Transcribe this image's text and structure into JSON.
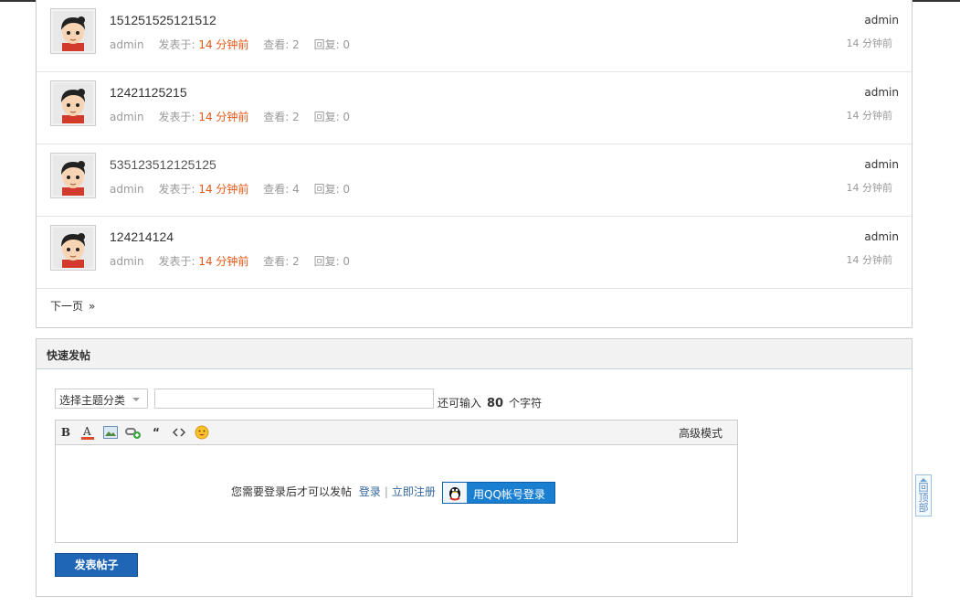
{
  "threads": [
    {
      "subject": "151251525121512",
      "author": "admin",
      "posted_label": "发表于:",
      "posted_time": "14 分钟前",
      "views": "查看: 2",
      "replies": "回复: 0",
      "last_author": "admin",
      "last_time": "14 分钟前"
    },
    {
      "subject": "12421125215",
      "author": "admin",
      "posted_label": "发表于:",
      "posted_time": "14 分钟前",
      "views": "查看: 2",
      "replies": "回复: 0",
      "last_author": "admin",
      "last_time": "14 分钟前"
    },
    {
      "subject": "535123512125125",
      "author": "admin",
      "posted_label": "发表于:",
      "posted_time": "14 分钟前",
      "views": "查看: 4",
      "replies": "回复: 0",
      "last_author": "admin",
      "last_time": "14 分钟前"
    },
    {
      "subject": "124214124",
      "author": "admin",
      "posted_label": "发表于:",
      "posted_time": "14 分钟前",
      "views": "查看: 2",
      "replies": "回复: 0",
      "last_author": "admin",
      "last_time": "14 分钟前"
    }
  ],
  "pagination": {
    "next_label": "下一页",
    "arrow": "»"
  },
  "quick_post": {
    "title": "快速发帖",
    "type_select": "选择主题分类",
    "subject_value": "",
    "char_hint_prefix": "还可输入",
    "char_count": "80",
    "char_hint_suffix": "个字符",
    "toolbar": {
      "bold": "B",
      "advanced_mode": "高级模式"
    },
    "login_prompt": "您需要登录后才可以发帖",
    "login_link": "登录",
    "separator": "|",
    "register_link": "立即注册",
    "qq_login": "用QQ帐号登录",
    "submit": "发表帖子"
  },
  "back_to_top": "回顶部",
  "colors": {
    "time_accent": "#e25817",
    "link": "#336699",
    "button_blue": "#1f66b7",
    "qq_blue": "#1a7fd0"
  },
  "icons": [
    "avatar-image",
    "bold-icon",
    "font-color-icon",
    "image-icon",
    "link-icon",
    "quote-icon",
    "code-icon",
    "smiley-icon",
    "qq-penguin-icon",
    "up-arrow-icon"
  ]
}
